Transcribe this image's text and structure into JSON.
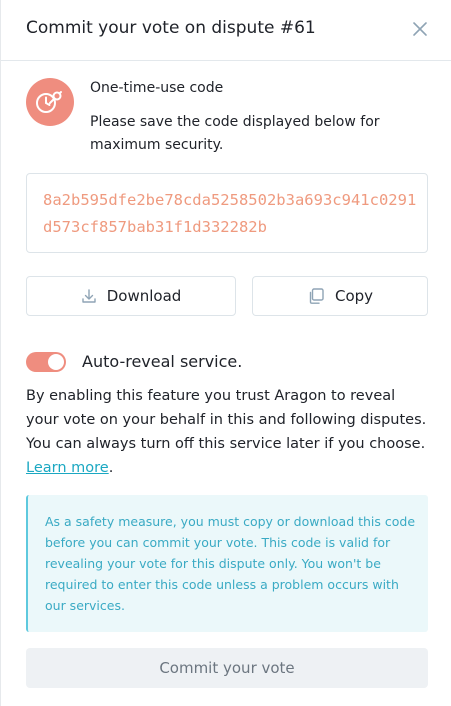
{
  "header": {
    "title": "Commit your vote on dispute #61",
    "close_icon": "close-icon"
  },
  "code_section": {
    "badge_icon": "clock-key-icon",
    "title": "One-time-use code",
    "description": "Please save the code displayed below for maximum security.",
    "code": "8a2b595dfe2be78cda5258502b3a693c941c0291d573cf857bab31f1d332282b"
  },
  "actions": {
    "download_label": "Download",
    "download_icon": "download-icon",
    "copy_label": "Copy",
    "copy_icon": "copy-icon"
  },
  "auto_reveal": {
    "label": "Auto-reveal service.",
    "enabled": true,
    "description": "By enabling this feature you trust Aragon to reveal your vote on your behalf in this and following disputes. You can always turn off this service later if you choose.",
    "link_label": "Learn more",
    "link_suffix": "."
  },
  "notice": {
    "text": "As a safety measure, you must copy or download this code before you can commit your vote. This code is valid for revealing your vote for this dispute only. You won't be required to enter this code unless a problem occurs with our services."
  },
  "commit": {
    "label": "Commit your vote"
  },
  "colors": {
    "accent": "#ef8d7f",
    "code_text": "#ef9a7f",
    "link": "#1ba8c2",
    "notice_bg": "#ebf8fa",
    "notice_text": "#3aaac4"
  }
}
